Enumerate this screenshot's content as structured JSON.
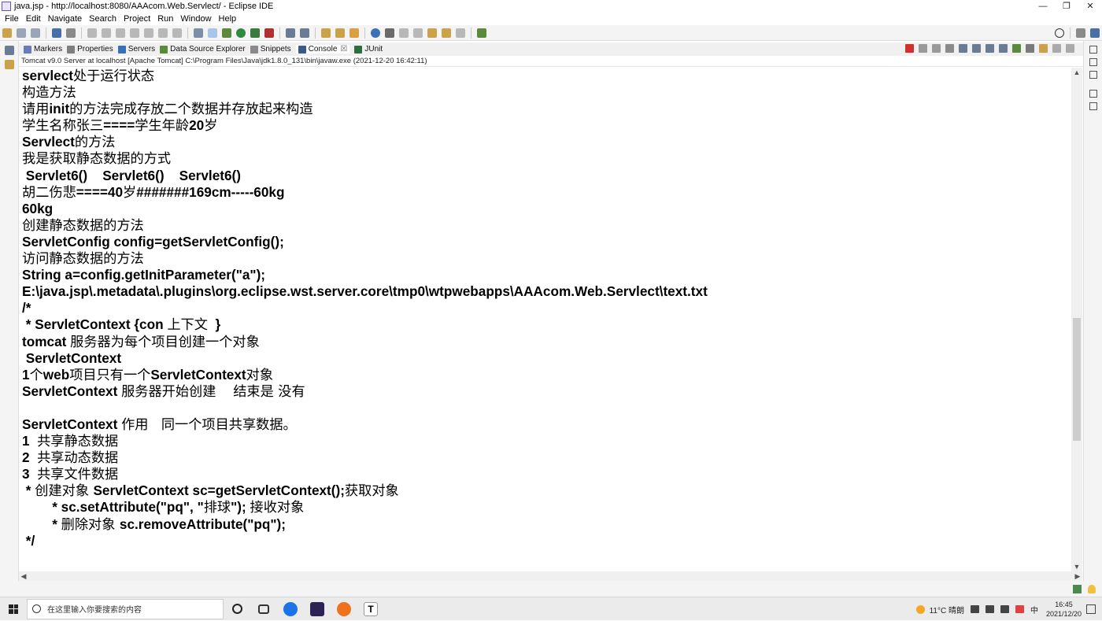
{
  "window": {
    "title": "java.jsp - http://localhost:8080/AAAcom.Web.Servlect/ - Eclipse IDE",
    "controls": [
      "—",
      "❐",
      "✕"
    ]
  },
  "menu": [
    "File",
    "Edit",
    "Navigate",
    "Search",
    "Project",
    "Run",
    "Window",
    "Help"
  ],
  "views": {
    "tabs": [
      {
        "label": "Markers",
        "icon": "markers-icon",
        "color": "#6a7bb5"
      },
      {
        "label": "Properties",
        "icon": "properties-icon",
        "color": "#7f7f7f"
      },
      {
        "label": "Servers",
        "icon": "servers-icon",
        "color": "#3b6fb6"
      },
      {
        "label": "Data Source Explorer",
        "icon": "data-source-icon",
        "color": "#5a8a3a"
      },
      {
        "label": "Snippets",
        "icon": "snippets-icon",
        "color": "#8a8a8a"
      },
      {
        "label": "Console",
        "icon": "console-icon",
        "color": "#3a5a8a",
        "active": true,
        "close": "☒"
      },
      {
        "label": "JUnit",
        "icon": "junit-icon",
        "color": "#2e6e3e"
      }
    ]
  },
  "console": {
    "description": "Tomcat v9.0 Server at localhost [Apache Tomcat] C:\\Program Files\\Java\\jdk1.8.0_131\\bin\\javaw.exe  (2021-12-20 16:42:11)",
    "lines": [
      [
        {
          "t": "servlect",
          "b": 1
        },
        {
          "t": "处于运行状态",
          "b": 0
        }
      ],
      [
        {
          "t": "构造方法",
          "b": 0
        }
      ],
      [
        {
          "t": "请用",
          "b": 0
        },
        {
          "t": "init",
          "b": 1
        },
        {
          "t": "的方法完成存放二个数据并存放起来构造",
          "b": 0
        }
      ],
      [
        {
          "t": "学生名称张三",
          "b": 0
        },
        {
          "t": "====",
          "b": 1
        },
        {
          "t": "学生年龄",
          "b": 0
        },
        {
          "t": "20",
          "b": 1
        },
        {
          "t": "岁",
          "b": 0
        }
      ],
      [
        {
          "t": "Servlect",
          "b": 1
        },
        {
          "t": "的方法",
          "b": 0
        }
      ],
      [
        {
          "t": "我是获取静态数据的方式",
          "b": 0
        }
      ],
      [
        {
          "t": " Servlet6()    Servlet6()    Servlet6()",
          "b": 1
        }
      ],
      [
        {
          "t": "胡二伤悲",
          "b": 0
        },
        {
          "t": "====40",
          "b": 1
        },
        {
          "t": "岁",
          "b": 0
        },
        {
          "t": "#######169cm-----60kg",
          "b": 1
        }
      ],
      [
        {
          "t": "60kg",
          "b": 1
        }
      ],
      [
        {
          "t": "创建静态数据的方法",
          "b": 0
        }
      ],
      [
        {
          "t": "ServletConfig config=getServletConfig();",
          "b": 1
        }
      ],
      [
        {
          "t": "访问静态数据的方法",
          "b": 0
        }
      ],
      [
        {
          "t": "String a=config.getInitParameter(\"a\");",
          "b": 1
        }
      ],
      [
        {
          "t": "E:\\java.jsp\\.metadata\\.plugins\\org.eclipse.wst.server.core\\tmp0\\wtpwebapps\\AAAcom.Web.Servlect\\text.txt",
          "b": 1
        }
      ],
      [
        {
          "t": "/*",
          "b": 1
        }
      ],
      [
        {
          "t": " * ServletContext {con ",
          "b": 1
        },
        {
          "t": "上下文",
          "b": 0
        },
        {
          "t": "  }",
          "b": 1
        }
      ],
      [
        {
          "t": "tomcat ",
          "b": 1
        },
        {
          "t": "服务器为每个项目创建一个对象",
          "b": 0
        }
      ],
      [
        {
          "t": " ServletContext",
          "b": 1
        }
      ],
      [
        {
          "t": "1",
          "b": 1
        },
        {
          "t": "个",
          "b": 0
        },
        {
          "t": "web",
          "b": 1
        },
        {
          "t": "项目只有一个",
          "b": 0
        },
        {
          "t": "ServletContext",
          "b": 1
        },
        {
          "t": "对象",
          "b": 0
        }
      ],
      [
        {
          "t": "ServletContext ",
          "b": 1
        },
        {
          "t": "服务器开始创建    结束是 没有",
          "b": 0
        }
      ],
      [
        {
          "t": "",
          "b": 0
        }
      ],
      [
        {
          "t": "ServletContext ",
          "b": 1
        },
        {
          "t": "作用   同一个项目共享数据。",
          "b": 0
        }
      ],
      [
        {
          "t": "1  ",
          "b": 1
        },
        {
          "t": "共享静态数据",
          "b": 0
        }
      ],
      [
        {
          "t": "2  ",
          "b": 1
        },
        {
          "t": "共享动态数据",
          "b": 0
        }
      ],
      [
        {
          "t": "3  ",
          "b": 1
        },
        {
          "t": "共享文件数据",
          "b": 0
        }
      ],
      [
        {
          "t": " * ",
          "b": 1
        },
        {
          "t": "创建对象 ",
          "b": 0
        },
        {
          "t": "ServletContext sc=getServletContext();",
          "b": 1
        },
        {
          "t": "获取对象",
          "b": 0
        }
      ],
      [
        {
          "t": "        * sc.setAttribute(\"pq\", \"",
          "b": 1
        },
        {
          "t": "排球",
          "b": 0
        },
        {
          "t": "\"); ",
          "b": 1
        },
        {
          "t": "接收对象",
          "b": 0
        }
      ],
      [
        {
          "t": "        * ",
          "b": 1
        },
        {
          "t": "删除对象 ",
          "b": 0
        },
        {
          "t": "sc.removeAttribute(\"pq\");",
          "b": 1
        }
      ],
      [
        {
          "t": " */",
          "b": 1
        }
      ]
    ]
  },
  "taskbar": {
    "search_placeholder": "在这里输入你要搜索的内容",
    "weather": "11°C  晴朗",
    "time": "16:45",
    "date": "2021/12/20",
    "input_mode": "中",
    "apps": [
      {
        "name": "task-view-app",
        "color": "#222222"
      },
      {
        "name": "multitask-app",
        "color": "#333333"
      },
      {
        "name": "k-app",
        "color": "#1a73e8"
      },
      {
        "name": "eclipse-app",
        "color": "#2c2255"
      },
      {
        "name": "orange-app",
        "color": "#f0711d"
      },
      {
        "name": "typora-app",
        "color": "#444444"
      }
    ]
  }
}
